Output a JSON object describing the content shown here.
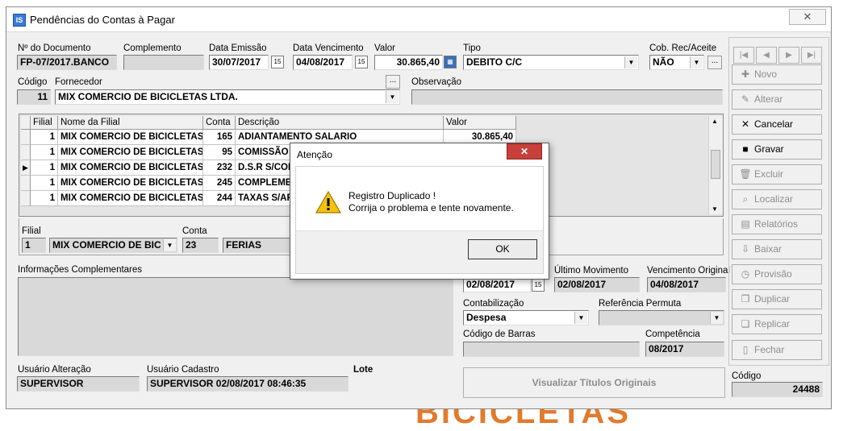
{
  "window": {
    "title": "Pendências do Contas à Pagar",
    "close": "✕",
    "icon_text": "IS"
  },
  "background": {
    "text": "BICICLETAS"
  },
  "doc": {
    "labels": {
      "numero": "Nº do Documento",
      "complemento": "Complemento",
      "data_emissao": "Data Emissão",
      "data_vencimento": "Data Vencimento",
      "valor": "Valor",
      "tipo": "Tipo",
      "cob": "Cob. Rec/Aceite",
      "codigo": "Código",
      "fornecedor": "Fornecedor",
      "observacao": "Observação"
    },
    "numero": "FP-07/2017.BANCO",
    "complemento": "",
    "data_emissao": "30/07/2017",
    "data_vencimento": "04/08/2017",
    "valor": "30.865,40",
    "tipo": "DEBITO C/C",
    "cob": "NÃO",
    "codigo": "11",
    "fornecedor": "MIX COMERCIO DE BICICLETAS LTDA.",
    "observacao": ""
  },
  "grid": {
    "columns": [
      "Filial",
      "Nome da Filial",
      "Conta",
      "Descrição",
      "Valor"
    ],
    "rows": [
      {
        "filial": "1",
        "nome": "MIX COMERCIO DE BICICLETAS",
        "conta": "165",
        "descricao": "ADIANTAMENTO SALARIO",
        "valor": "30.865,40"
      },
      {
        "filial": "1",
        "nome": "MIX COMERCIO DE BICICLETAS",
        "conta": "95",
        "descricao": "COMISSÃO S",
        "valor": ""
      },
      {
        "filial": "1",
        "nome": "MIX COMERCIO DE BICICLETAS",
        "conta": "232",
        "descricao": "D.S.R S/COM",
        "valor": ""
      },
      {
        "filial": "1",
        "nome": "MIX COMERCIO DE BICICLETAS",
        "conta": "245",
        "descricao": "COMPLEMEN",
        "valor": ""
      },
      {
        "filial": "1",
        "nome": "MIX COMERCIO DE BICICLETAS",
        "conta": "244",
        "descricao": "TAXAS S/AP",
        "valor": ""
      }
    ]
  },
  "detail": {
    "labels": {
      "filial": "Filial",
      "conta": "Conta"
    },
    "filial_num": "1",
    "filial_nome": "MIX COMERCIO DE BIC",
    "conta_num": "23",
    "conta_desc": "FERIAS"
  },
  "info": {
    "label": "Informações Complementares",
    "value": ""
  },
  "lower": {
    "data_field": "02/08/2017",
    "ultimo_label": "Último Movimento",
    "ultimo": "02/08/2017",
    "venc_orig_label": "Vencimento Original",
    "venc_orig": "04/08/2017",
    "contab_label": "Contabilização",
    "contab": "Despesa",
    "ref_label": "Referência Permuta",
    "ref": "",
    "barras_label": "Código de Barras",
    "barras": "",
    "competencia_label": "Competência",
    "competencia": "08/2017",
    "visualizar": "Visualizar Títulos Originais"
  },
  "users": {
    "alteracao_label": "Usuário Alteração",
    "alteracao": "SUPERVISOR",
    "cadastro_label": "Usuário Cadastro",
    "cadastro": "SUPERVISOR 02/08/2017 08:46:35",
    "lote_label": "Lote"
  },
  "side": {
    "nav": [
      "|◀",
      "◀",
      "▶",
      "▶|"
    ],
    "buttons": [
      {
        "label": "Novo",
        "icon": "✚"
      },
      {
        "label": "Alterar",
        "icon": "✎"
      },
      {
        "label": "Cancelar",
        "icon": "✕"
      },
      {
        "label": "Gravar",
        "icon": "■"
      },
      {
        "label": "Excluir",
        "icon": "🗑"
      },
      {
        "label": "Localizar",
        "icon": "⌕"
      },
      {
        "label": "Relatórios",
        "icon": "▤"
      },
      {
        "label": "Baixar",
        "icon": "⇩"
      },
      {
        "label": "Provisão",
        "icon": "◷"
      },
      {
        "label": "Duplicar",
        "icon": "❐"
      },
      {
        "label": "Replicar",
        "icon": "❏"
      },
      {
        "label": "Fechar",
        "icon": "▯"
      }
    ],
    "codigo_label": "Código",
    "codigo": "24488"
  },
  "dialog": {
    "title": "Atenção",
    "close": "✕",
    "line1": "Registro Duplicado !",
    "line2": "Corrija o problema e tente novamente.",
    "ok": "OK"
  }
}
